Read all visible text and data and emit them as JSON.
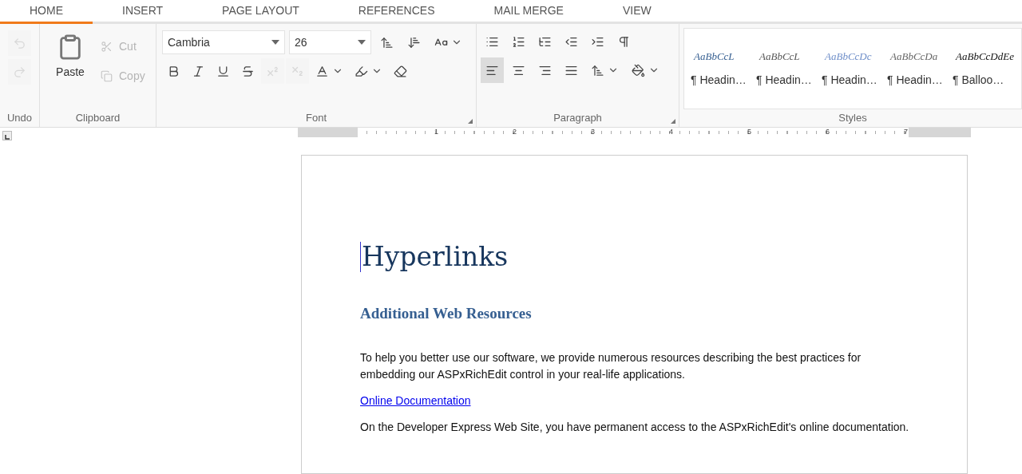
{
  "tabs": [
    {
      "label": "HOME",
      "selected": true
    },
    {
      "label": "INSERT",
      "selected": false
    },
    {
      "label": "PAGE LAYOUT",
      "selected": false
    },
    {
      "label": "REFERENCES",
      "selected": false
    },
    {
      "label": "MAIL MERGE",
      "selected": false
    },
    {
      "label": "VIEW",
      "selected": false
    }
  ],
  "undo_group": {
    "label": "Undo",
    "buttons": [
      {
        "kind": "undo",
        "disabled": true
      },
      {
        "kind": "redo",
        "disabled": true
      }
    ]
  },
  "clipboard_group": {
    "label": "Clipboard",
    "paste": "Paste",
    "buttons": [
      {
        "kind": "cut",
        "label": "Cut",
        "disabled": true
      },
      {
        "kind": "copy",
        "label": "Copy",
        "disabled": true
      }
    ]
  },
  "font_group": {
    "label": "Font",
    "font_name": "Cambria",
    "font_size": "26",
    "top_buttons": [
      {
        "kind": "grow",
        "disabled": false
      },
      {
        "kind": "shrink",
        "disabled": false
      },
      {
        "kind": "case",
        "disabled": false
      }
    ],
    "bottom_buttons": [
      {
        "kind": "bold",
        "disabled": false
      },
      {
        "kind": "italic",
        "disabled": false
      },
      {
        "kind": "underline",
        "disabled": false
      },
      {
        "kind": "strike",
        "disabled": false
      },
      {
        "kind": "superscript",
        "disabled": true
      },
      {
        "kind": "subscript",
        "disabled": true
      },
      {
        "kind": "font-color",
        "disabled": false
      },
      {
        "kind": "highlight",
        "disabled": false
      },
      {
        "kind": "clear-format",
        "disabled": false
      }
    ]
  },
  "paragraph_group": {
    "label": "Paragraph",
    "top_buttons": [
      {
        "kind": "bullets",
        "selected": false
      },
      {
        "kind": "numbering",
        "selected": false
      },
      {
        "kind": "multilevel",
        "selected": false
      },
      {
        "kind": "outdent",
        "selected": false
      },
      {
        "kind": "indent",
        "selected": false
      },
      {
        "kind": "pilcrow",
        "selected": false
      }
    ],
    "bottom_buttons": [
      {
        "kind": "align-left",
        "selected": true
      },
      {
        "kind": "align-center",
        "selected": false
      },
      {
        "kind": "align-right",
        "selected": false
      },
      {
        "kind": "justify",
        "selected": false
      },
      {
        "kind": "line-spacing",
        "selected": false
      },
      {
        "kind": "shading",
        "selected": false
      }
    ]
  },
  "styles_group": {
    "label": "Styles",
    "items": [
      {
        "preview": "AaBbCcL",
        "name": "¶ Headin…",
        "color": "#365f91"
      },
      {
        "preview": "AaBbCcL",
        "name": "¶ Headin…",
        "color": "#555555"
      },
      {
        "preview": "AaBbCcDc",
        "name": "¶ Headin…",
        "color": "#6f8fc9"
      },
      {
        "preview": "AaBbCcDa",
        "name": "¶ Headin…",
        "color": "#666666"
      },
      {
        "preview": "AaBbCcDdEe",
        "name": "¶ Balloo…",
        "color": "#111111"
      }
    ]
  },
  "ruler": {
    "numbers": [
      "1",
      "2",
      "3",
      "4",
      "5",
      "6",
      "7"
    ]
  },
  "document": {
    "title": "Hyperlinks",
    "heading": "Additional Web Resources",
    "paragraphs": [
      {
        "kind": "text",
        "text": "To help you better use our software, we provide numerous resources describing the best practices for embedding our ASPxRichEdit control in your real-life applications."
      },
      {
        "kind": "link",
        "text": "Online Documentation"
      },
      {
        "kind": "text",
        "text": "On the Developer Express Web Site, you have permanent access to the ASPxRichEdit's online documentation."
      }
    ]
  }
}
